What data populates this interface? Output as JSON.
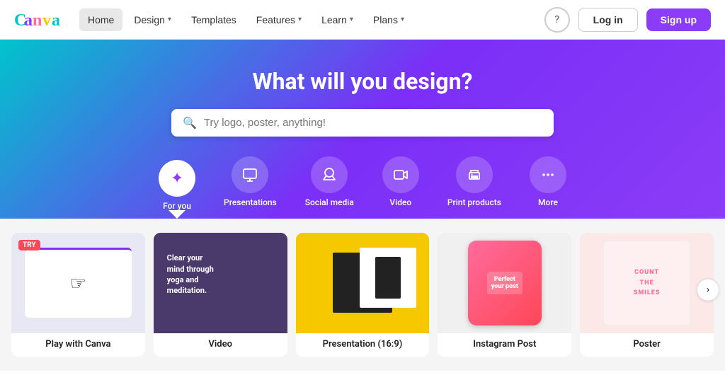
{
  "nav": {
    "logo_text": "Canva",
    "items": [
      {
        "label": "Home",
        "active": true,
        "has_chevron": false
      },
      {
        "label": "Design",
        "active": false,
        "has_chevron": true
      },
      {
        "label": "Templates",
        "active": false,
        "has_chevron": false
      },
      {
        "label": "Features",
        "active": false,
        "has_chevron": true
      },
      {
        "label": "Learn",
        "active": false,
        "has_chevron": true
      },
      {
        "label": "Plans",
        "active": false,
        "has_chevron": true
      }
    ],
    "help_icon": "?",
    "login_label": "Log in",
    "signup_label": "Sign up"
  },
  "hero": {
    "title": "What will you design?",
    "search_placeholder": "Try logo, poster, anything!"
  },
  "categories": [
    {
      "id": "for-you",
      "label": "For you",
      "icon": "✦",
      "active": true
    },
    {
      "id": "presentations",
      "label": "Presentations",
      "icon": "🖥",
      "active": false
    },
    {
      "id": "social-media",
      "label": "Social media",
      "icon": "♡",
      "active": false
    },
    {
      "id": "video",
      "label": "Video",
      "icon": "▶",
      "active": false
    },
    {
      "id": "print-products",
      "label": "Print products",
      "icon": "🖨",
      "active": false
    },
    {
      "id": "more",
      "label": "More",
      "icon": "•••",
      "active": false
    }
  ],
  "cards": [
    {
      "id": "play-canva",
      "label": "Play with Canva",
      "badge": "TRY",
      "type": "play"
    },
    {
      "id": "video",
      "label": "Video",
      "badge": null,
      "type": "video"
    },
    {
      "id": "presentation",
      "label": "Presentation (16:9)",
      "badge": null,
      "type": "presentation"
    },
    {
      "id": "instagram-post",
      "label": "Instagram Post",
      "badge": null,
      "type": "instagram"
    },
    {
      "id": "poster",
      "label": "Poster",
      "badge": null,
      "type": "poster"
    }
  ],
  "next_arrow": "›"
}
